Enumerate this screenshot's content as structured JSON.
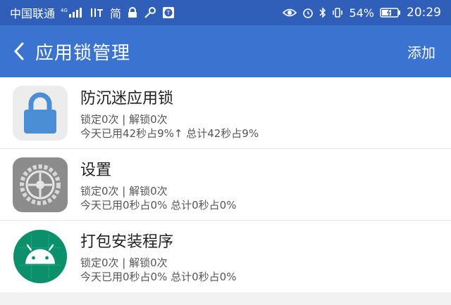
{
  "statusbar": {
    "carrier": "中国联通",
    "signal_label": "4G",
    "app_label": "简",
    "battery": "54%",
    "time": "20:29"
  },
  "appbar": {
    "title": "应用锁管理",
    "add_label": "添加"
  },
  "apps": [
    {
      "name": "防沉迷应用锁",
      "counts": "锁定0次 | 解锁0次",
      "usage": "今天已用42秒占9%↑ 总计42秒占9%",
      "icon": "lock-icon"
    },
    {
      "name": "设置",
      "counts": "锁定0次 | 解锁0次",
      "usage": "今天已用0秒占0% 总计0秒占0%",
      "icon": "gear-icon"
    },
    {
      "name": "打包安装程序",
      "counts": "锁定0次 | 解锁0次",
      "usage": "今天已用0秒占0% 总计0秒占0%",
      "icon": "android-icon"
    }
  ],
  "colors": {
    "statusbar": "#2f5fb8",
    "appbar": "#3b73d1",
    "lock_icon": "#4a8fd6",
    "android_icon": "#0c8f6b"
  }
}
